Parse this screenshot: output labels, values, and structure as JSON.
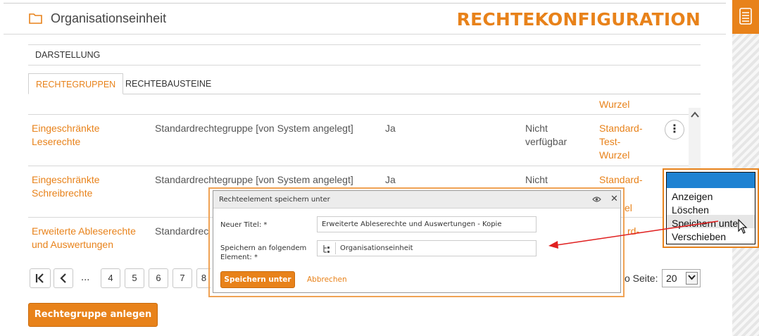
{
  "header": {
    "title": "Organisationseinheit",
    "brand": "RECHTEKONFIGURATION"
  },
  "section": {
    "label": "DARSTELLUNG"
  },
  "tabs": [
    {
      "label": "RECHTEGRUPPEN",
      "active": true
    },
    {
      "label": "RECHTEBAUSTEINE",
      "active": false
    }
  ],
  "table": {
    "column_header_root": "Wurzel",
    "rows": [
      {
        "name": "Eingeschränkte Leserechte",
        "type": "Standardrechtegruppe [von System angelegt]",
        "flag": "Ja",
        "availability": "Nicht verfügbar",
        "root": "Standard-Test-Wurzel"
      },
      {
        "name": "Eingeschränkte Schreibrechte",
        "type": "Standardrechtegruppe [von System angelegt]",
        "flag": "Ja",
        "availability": "Nicht",
        "root_part1": "Standard-",
        "root_part3": "el"
      },
      {
        "name": "Erweiterte Ableserechte und Auswertungen",
        "type": "Standardrec",
        "root_part2": "rd-"
      }
    ]
  },
  "pagination": {
    "first": "K",
    "prev": "<",
    "ellipsis": "...",
    "pages": [
      "4",
      "5",
      "6",
      "7",
      "8"
    ],
    "per_page_label": "o Seite:",
    "per_page_value": "20"
  },
  "create_button": "Rechtegruppe anlegen",
  "context_menu": {
    "items": [
      "Anzeigen",
      "Löschen",
      "Speichern unter",
      "Verschieben"
    ]
  },
  "modal": {
    "title": "Rechteelement speichern unter",
    "title_label": "Neuer Titel: *",
    "title_value": "Erweiterte Ableserechte und Auswertungen - Kopie",
    "target_label_line1": "Speichern an folgendem",
    "target_label_line2": "Element: *",
    "target_value": "Organisationseinheit",
    "save_button": "Speichern unter",
    "cancel_button": "Abbrechen"
  },
  "colors": {
    "accent": "#e8821a",
    "selection": "#1e82d2",
    "annotation": "#e02020"
  }
}
